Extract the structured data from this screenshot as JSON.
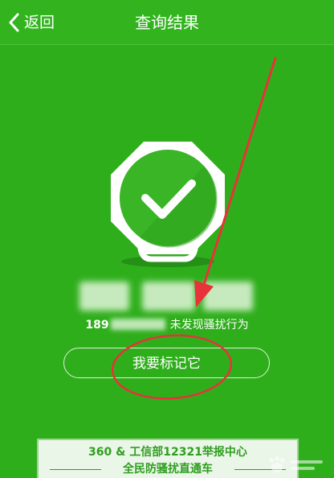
{
  "navbar": {
    "back_label": "返回",
    "title": "查询结果"
  },
  "result": {
    "number_prefix": "189",
    "status_text": "未发现骚扰行为"
  },
  "actions": {
    "mark_label": "我要标记它"
  },
  "banner": {
    "line1": "360 & 工信部12321举报中心",
    "line2": "全民防骚扰直通车"
  },
  "colors": {
    "background": "#2fae1c",
    "annotation": "#e8323a"
  },
  "icons": {
    "back": "chevron-left-icon",
    "badge": "check-shield-icon"
  }
}
